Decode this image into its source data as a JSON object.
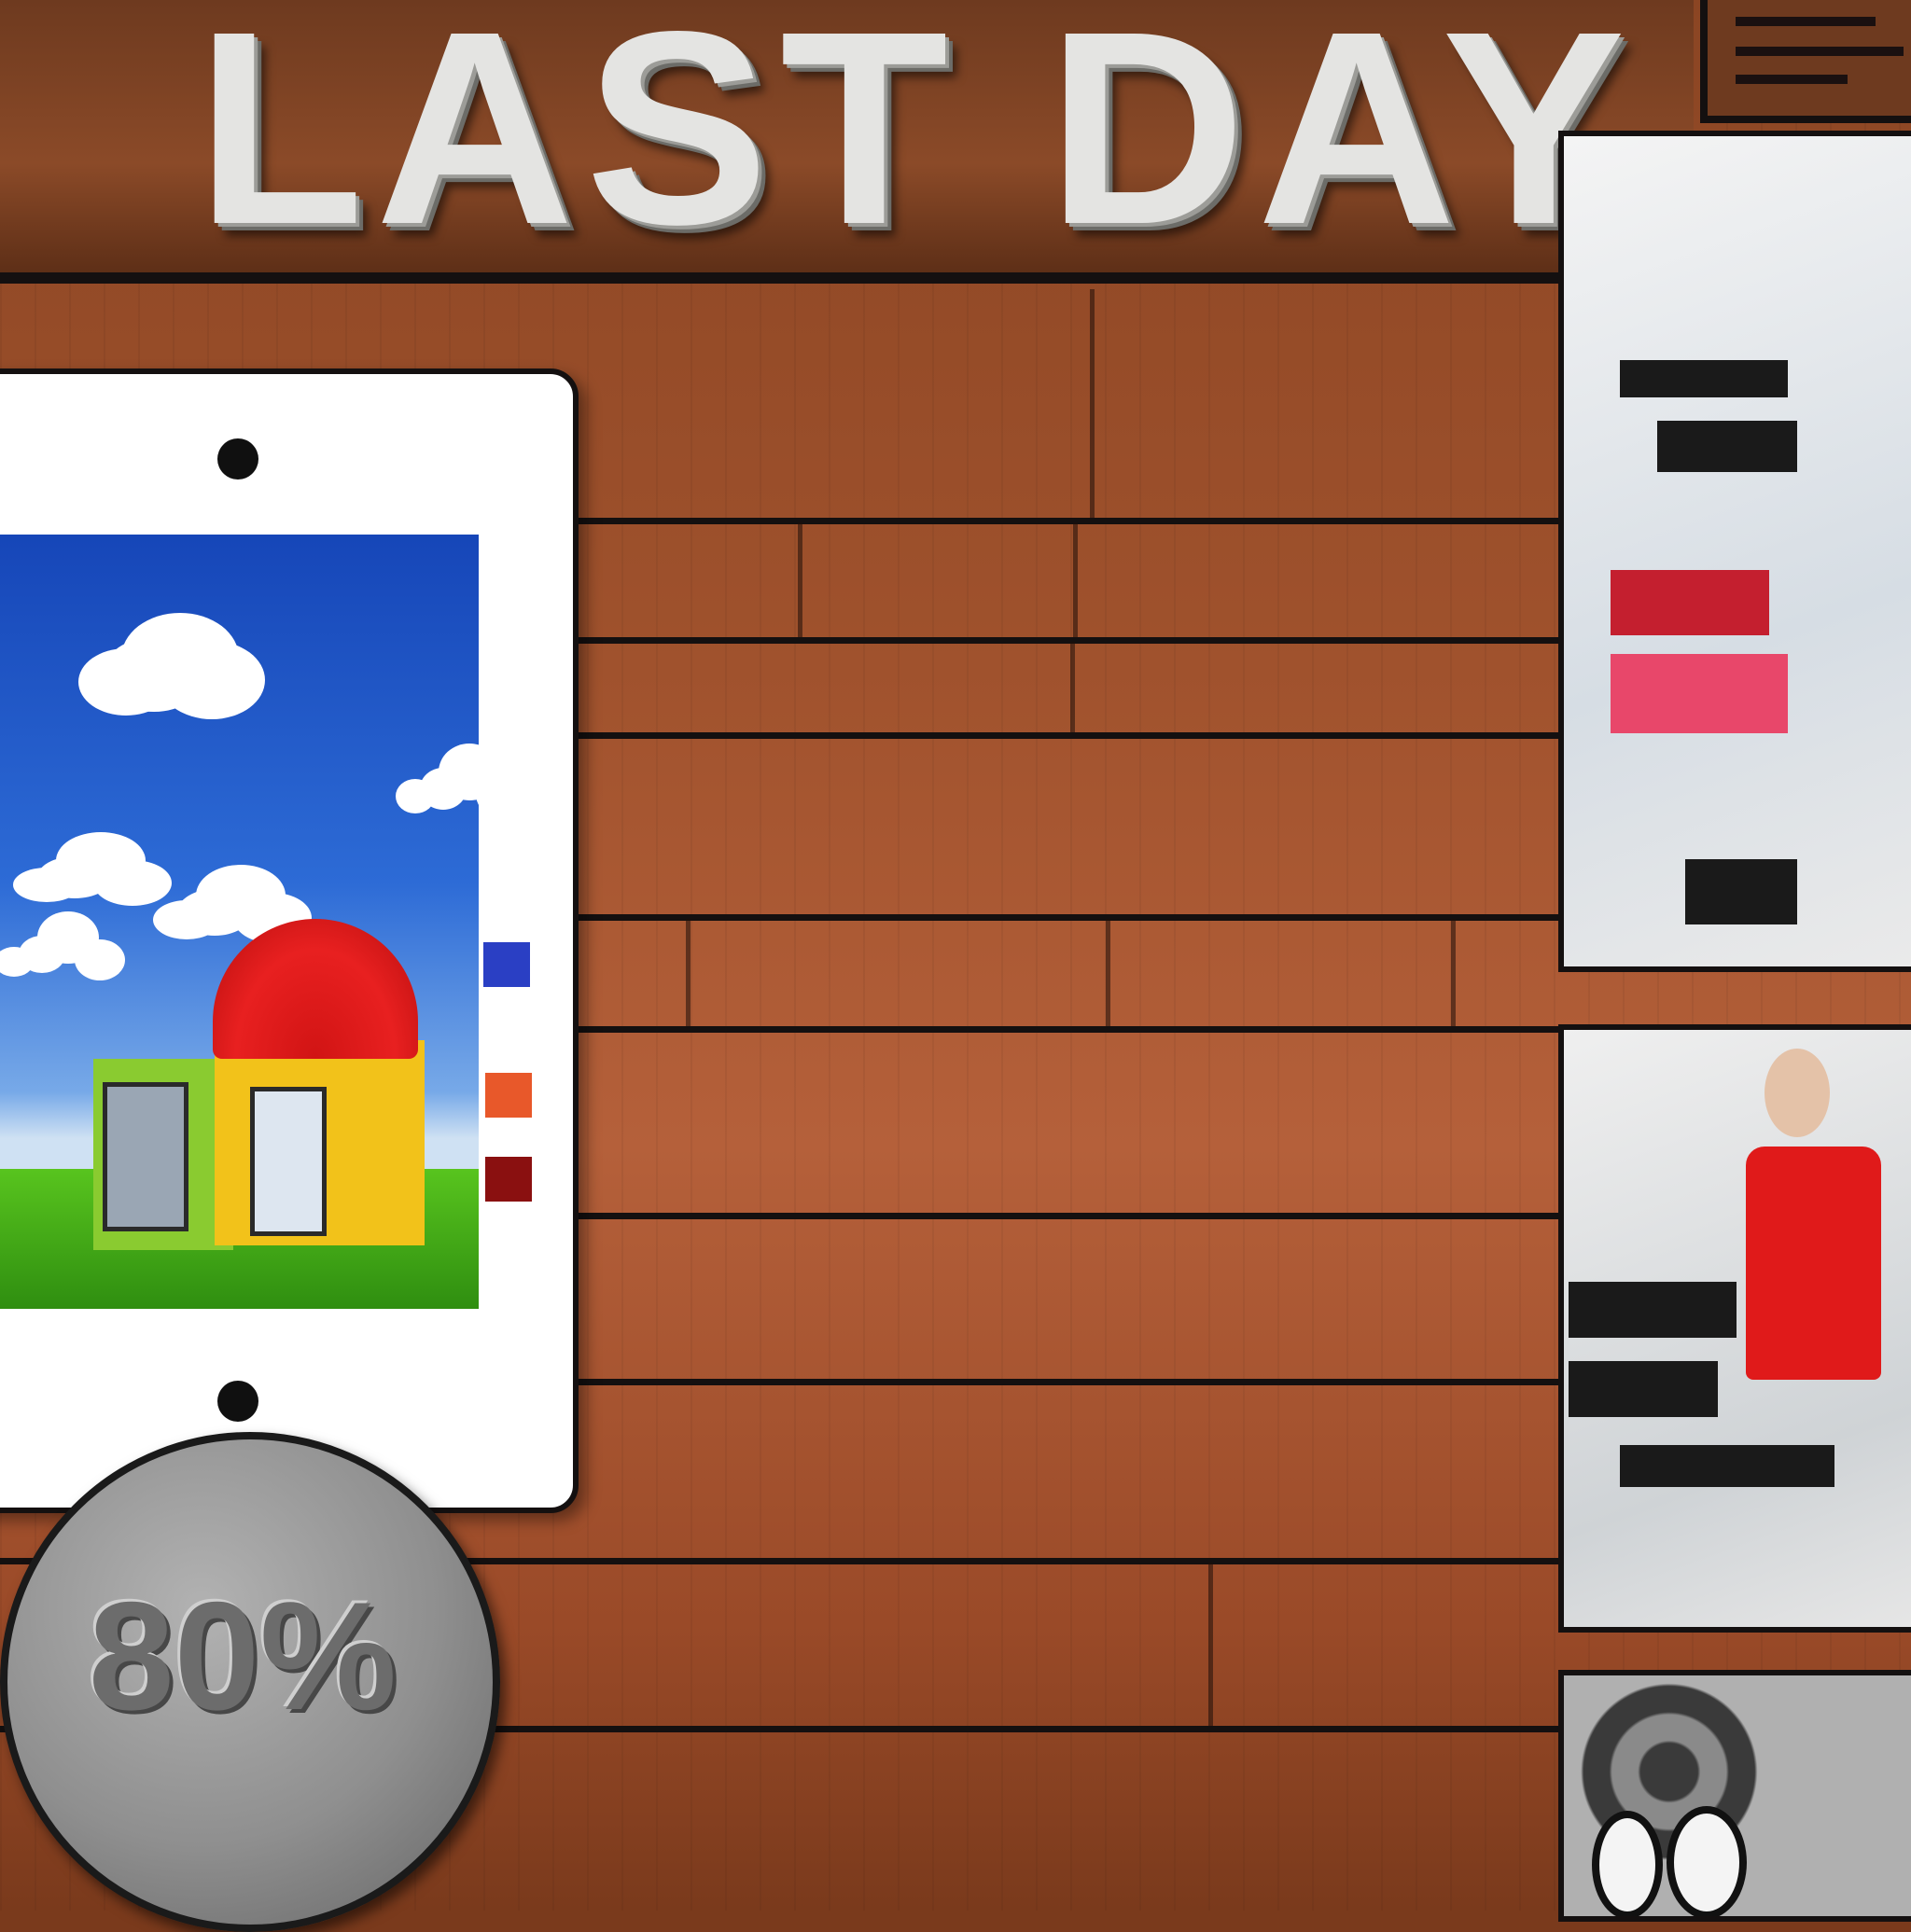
{
  "sign": {
    "text": "LAST DAY"
  },
  "badge": {
    "text": "80%"
  },
  "colors": {
    "wood": "#a0522d",
    "sign_letters": "#e4e4e2",
    "frame": "#ffffff",
    "sky": "#2d6bd6",
    "grass": "#58c41e",
    "roof": "#e82020",
    "house_wall": "#f2c21a",
    "coin": "#8f8f8f",
    "poster_red": "#e01a1a"
  }
}
